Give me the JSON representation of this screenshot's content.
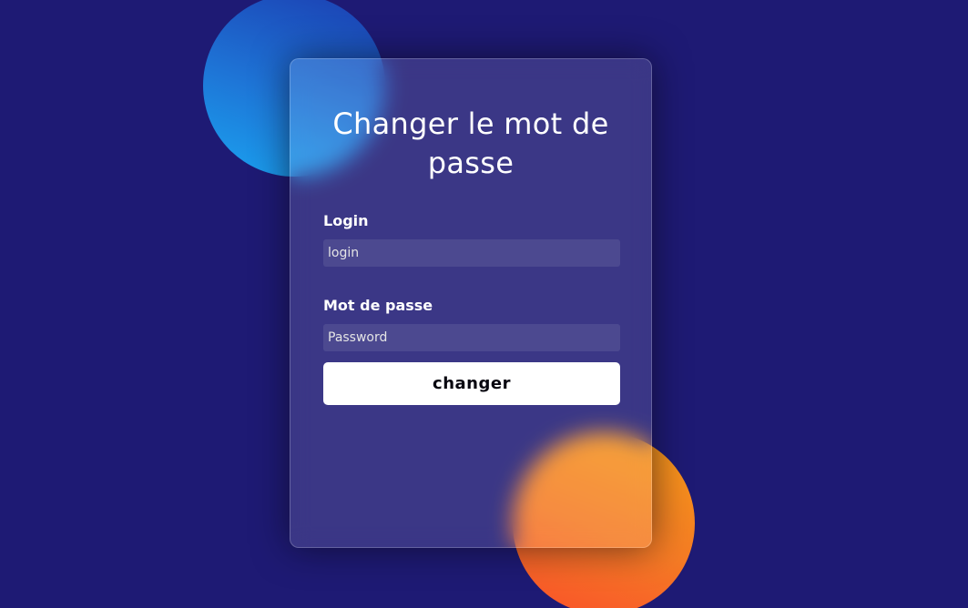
{
  "form": {
    "title": "Changer le mot de passe",
    "login_label": "Login",
    "login_placeholder": "login",
    "password_label": "Mot de passe",
    "password_placeholder": "Password",
    "submit_label": "changer"
  },
  "colors": {
    "background": "#1e1a74",
    "shape_blue": "#1e74d6",
    "shape_orange": "#f57a25",
    "button_background": "#ffffff",
    "button_text": "#080710"
  }
}
